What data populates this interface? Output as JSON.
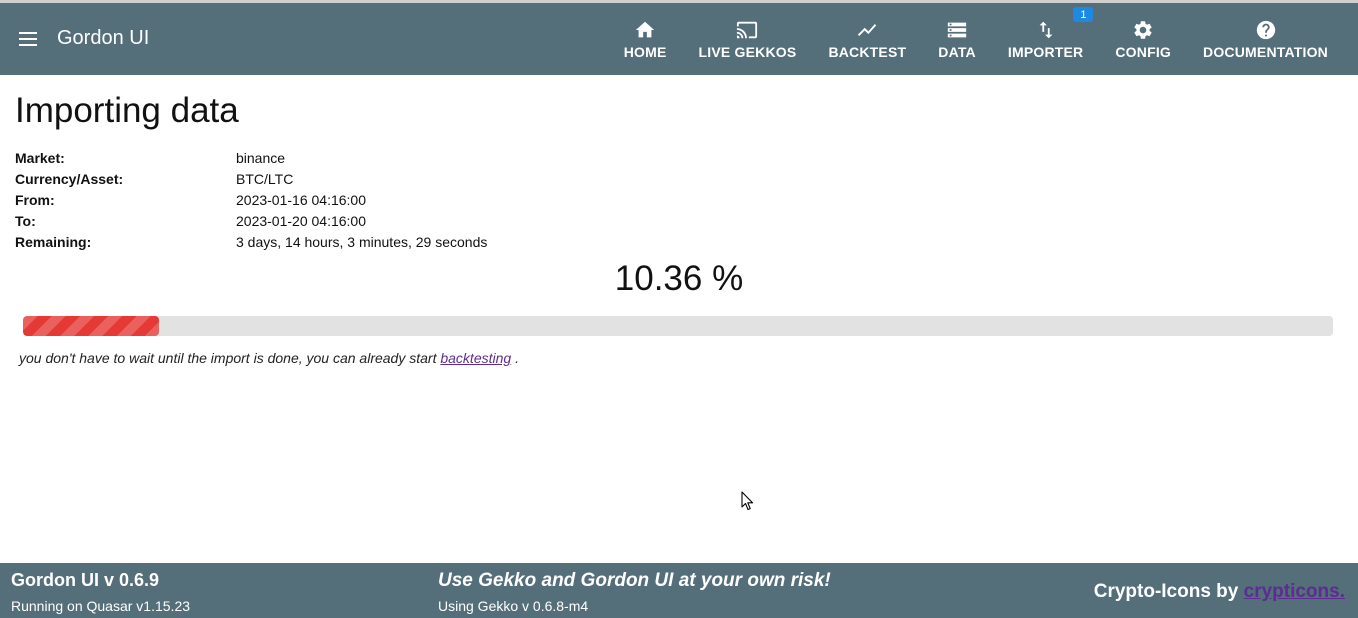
{
  "app": {
    "title": "Gordon UI"
  },
  "nav": {
    "home": "HOME",
    "live_gekkos": "LIVE GEKKOS",
    "backtest": "BACKTEST",
    "data": "DATA",
    "importer": "IMPORTER",
    "importer_badge": "1",
    "config": "CONFIG",
    "documentation": "DOCUMENTATION"
  },
  "page": {
    "title": "Importing data",
    "fields": {
      "market_label": "Market:",
      "market_value": "binance",
      "currency_label": "Currency/Asset:",
      "currency_value": "BTC/LTC",
      "from_label": "From:",
      "from_value": "2023-01-16 04:16:00",
      "to_label": "To:",
      "to_value": "2023-01-20 04:16:00",
      "remaining_label": "Remaining:",
      "remaining_value": "3 days, 14 hours, 3 minutes, 29 seconds"
    },
    "progress_text": "10.36 %",
    "progress_value": 10.36,
    "progress_color": "#e53935",
    "hint_text": "you don't have to wait until the import is done, you can already start",
    "hint_link": "backtesting",
    "hint_end": "."
  },
  "footer": {
    "title": "Gordon UI v 0.6.9",
    "runtime": "Running on Quasar v1.15.23",
    "warning": "Use Gekko and Gordon UI at your own risk!",
    "gekko_version": "Using Gekko v 0.6.8-m4",
    "credit": "Crypto-Icons by",
    "credit_link": "crypticons."
  },
  "colors": {
    "header": "#546e7a",
    "badge": "#1e88e5",
    "link": "#5c2d91"
  },
  "icons": [
    "menu-icon",
    "home-icon",
    "cast-icon",
    "show-chart-icon",
    "storage-icon",
    "import-export-icon",
    "settings-icon",
    "help-icon",
    "mouse-cursor-icon"
  ]
}
